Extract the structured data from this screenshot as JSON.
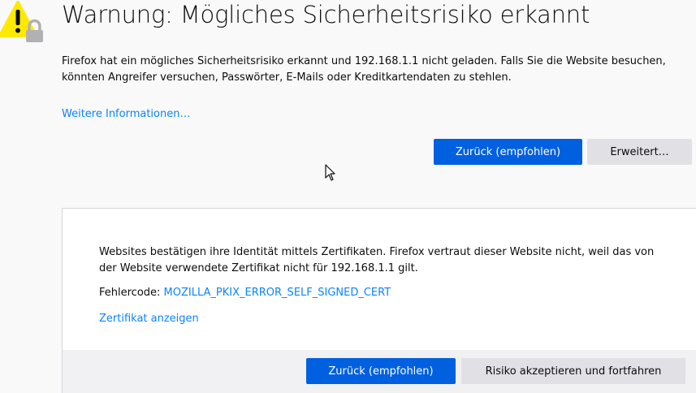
{
  "page": {
    "title": "Warnung: Mögliches Sicherheitsrisiko erkannt",
    "intro": "Firefox hat ein mögliches Sicherheitsrisiko erkannt und 192.168.1.1 nicht geladen. Falls Sie die Website besuchen, könnten Angreifer versuchen, Passwörter, E-Mails oder Kreditkartendaten zu stehlen.",
    "more_info_link": "Weitere Informationen…",
    "back_button": "Zurück (empfohlen)",
    "advanced_button": "Erweitert…"
  },
  "advanced_panel": {
    "text": "Websites bestätigen ihre Identität mittels Zertifikaten. Firefox vertraut dieser Website nicht, weil das von der Website verwendete Zertifikat nicht für 192.168.1.1 gilt.",
    "error_label": "Fehlercode: ",
    "error_code": "MOZILLA_PKIX_ERROR_SELF_SIGNED_CERT",
    "view_cert_link": "Zertifikat anzeigen",
    "back_button": "Zurück (empfohlen)",
    "accept_button": "Risiko akzeptieren und fortfahren"
  },
  "icons": {
    "warning": "warning-lock-icon",
    "cursor": "mouse-cursor-icon"
  },
  "colors": {
    "primary": "#0060df",
    "link": "#0a84ff",
    "warning": "#ffe900"
  }
}
